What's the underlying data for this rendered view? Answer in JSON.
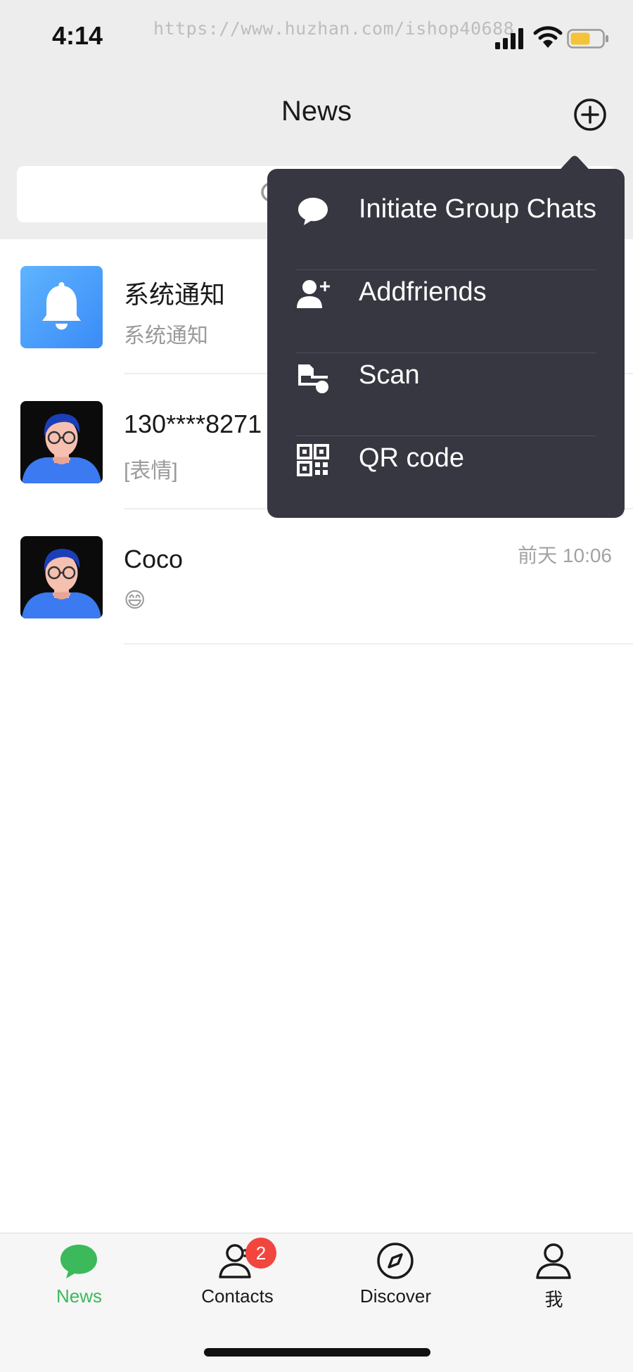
{
  "status_bar": {
    "time": "4:14",
    "watermark": "https://www.huzhan.com/ishop40688",
    "battery_color": "#f4c33a"
  },
  "header": {
    "title": "News",
    "add_icon": "plus-circle-icon"
  },
  "search": {
    "icon": "search-icon"
  },
  "chats": [
    {
      "name": "系统通知",
      "preview": "系统通知",
      "time": "",
      "avatar": "bell-icon"
    },
    {
      "name": "130****8271",
      "preview": "[表情]",
      "time": "",
      "avatar": "man-glasses-avatar"
    },
    {
      "name": "Coco",
      "preview": "😄",
      "time": "前天 10:06",
      "avatar": "man-glasses-avatar"
    }
  ],
  "popup_menu": {
    "items": [
      {
        "label": "Initiate Group Chats",
        "icon": "chat-bubble-icon"
      },
      {
        "label": "Addfriends",
        "icon": "add-user-icon"
      },
      {
        "label": "Scan",
        "icon": "scan-icon"
      },
      {
        "label": "QR code",
        "icon": "qr-code-icon"
      }
    ]
  },
  "tab_bar": {
    "tabs": [
      {
        "label": "News",
        "icon": "chat-bubble-icon",
        "active": true
      },
      {
        "label": "Contacts",
        "icon": "contacts-icon",
        "badge": "2"
      },
      {
        "label": "Discover",
        "icon": "compass-icon"
      },
      {
        "label": "我",
        "icon": "person-icon"
      }
    ],
    "active_color": "#3cb95a"
  }
}
